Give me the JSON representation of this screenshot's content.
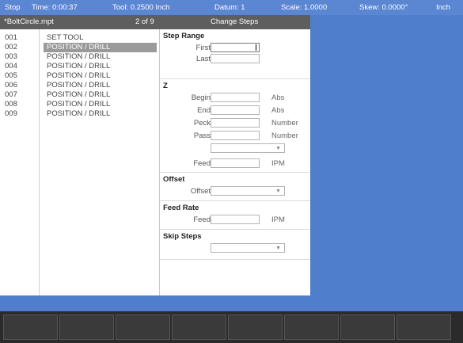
{
  "status": {
    "state": "Stop",
    "time": "Time: 0:00:37",
    "tool": "Tool: 0.2500 Inch",
    "datum": "Datum: 1",
    "scale": "Scale: 1.0000",
    "skew": "Skew: 0.0000°",
    "unit": "Inch"
  },
  "titlebar": {
    "filename": "*BoltCircle.mpt",
    "position": "2 of 9",
    "dialog_title": "Change Steps"
  },
  "steps": [
    {
      "num": "001",
      "name": "SET TOOL",
      "selected": false
    },
    {
      "num": "002",
      "name": "POSITION / DRILL",
      "selected": true
    },
    {
      "num": "003",
      "name": "POSITION / DRILL",
      "selected": false
    },
    {
      "num": "004",
      "name": "POSITION / DRILL",
      "selected": false
    },
    {
      "num": "005",
      "name": "POSITION / DRILL",
      "selected": false
    },
    {
      "num": "006",
      "name": "POSITION / DRILL",
      "selected": false
    },
    {
      "num": "007",
      "name": "POSITION / DRILL",
      "selected": false
    },
    {
      "num": "008",
      "name": "POSITION / DRILL",
      "selected": false
    },
    {
      "num": "009",
      "name": "POSITION / DRILL",
      "selected": false
    }
  ],
  "form": {
    "step_range": {
      "heading": "Step Range",
      "first_label": "First",
      "last_label": "Last",
      "first_value": "",
      "last_value": ""
    },
    "z": {
      "heading": "Z",
      "begin_label": "Begin",
      "begin_unit": "Abs",
      "begin_value": "",
      "end_label": "End",
      "end_unit": "Abs",
      "end_value": "",
      "peck_label": "Peck",
      "peck_unit": "Number",
      "peck_value": "",
      "pass_label": "Pass",
      "pass_unit": "Number",
      "pass_value": "",
      "mode_value": "",
      "feed_label": "Feed",
      "feed_unit": "IPM",
      "feed_value": ""
    },
    "offset": {
      "heading": "Offset",
      "offset_label": "Offset",
      "offset_value": ""
    },
    "feed_rate": {
      "heading": "Feed Rate",
      "feed_label": "Feed",
      "feed_unit": "IPM",
      "feed_value": ""
    },
    "skip_steps": {
      "heading": "Skip Steps",
      "value": ""
    }
  },
  "softkeys": [
    "",
    "",
    "",
    "",
    "",
    "",
    "",
    ""
  ],
  "colors": {
    "background": "#4f7fcc",
    "status_bar": "#5a86d2",
    "title_bar": "#5e5e5e",
    "selection": "#9a9a9a",
    "softkey_bar": "#2b2b2b"
  }
}
